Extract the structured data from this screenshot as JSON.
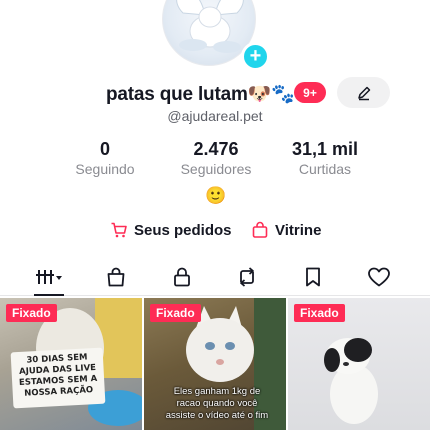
{
  "profile": {
    "name": "patas que lutam🐶🐾",
    "badge": "9+",
    "handle": "@ajudareal.pet",
    "bio_emoji": "🙂"
  },
  "stats": [
    {
      "value": "0",
      "label": "Seguindo"
    },
    {
      "value": "2.476",
      "label": "Seguidores"
    },
    {
      "value": "31,1 mil",
      "label": "Curtidas"
    }
  ],
  "links": {
    "orders": "Seus pedidos",
    "showcase": "Vitrine"
  },
  "tabs": [
    "videos-grid-icon",
    "shop-bag-icon",
    "lock-icon",
    "repost-icon",
    "bookmark-icon",
    "heart-icon"
  ],
  "videos": [
    {
      "pinned": "Fixado",
      "sign_text": "30 DIAS SEM AJUDA DAS LIVE ESTAMOS SEM A NOSSA RAÇÃO"
    },
    {
      "pinned": "Fixado",
      "caption": "Eles ganham 1kg de racao quando você assiste o vídeo até o fim"
    },
    {
      "pinned": "Fixado"
    }
  ],
  "colors": {
    "accent": "#fe2c55",
    "add": "#20d5ec",
    "text": "#161823",
    "muted": "#8a8b91"
  }
}
